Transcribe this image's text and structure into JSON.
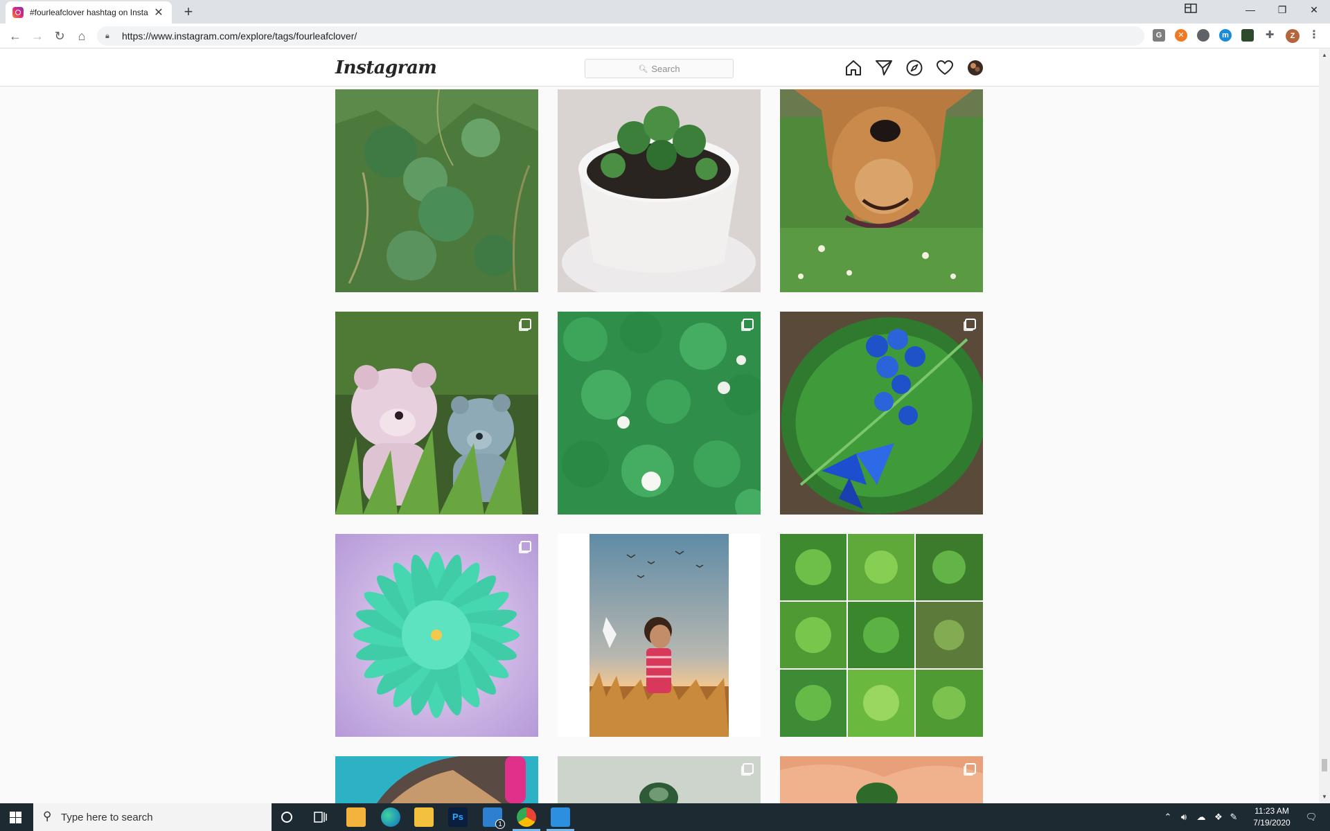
{
  "browser": {
    "tab_title": "#fourleafclover hashtag on Insta",
    "tab_close": "✕",
    "new_tab": "+",
    "url": "https://www.instagram.com/explore/tags/fourleafclover/",
    "profile_initial": "Z"
  },
  "instagram": {
    "logo": "Instagram",
    "search_placeholder": "Search"
  },
  "posts": [
    {
      "subject": "clover-leaves",
      "multi": false
    },
    {
      "subject": "potted-clover",
      "multi": false
    },
    {
      "subject": "dog-in-grass",
      "multi": false
    },
    {
      "subject": "teddy-bears",
      "multi": true
    },
    {
      "subject": "clover-field",
      "multi": true
    },
    {
      "subject": "blue-flowers-leaf",
      "multi": true
    },
    {
      "subject": "teal-flower",
      "multi": true
    },
    {
      "subject": "child-in-field",
      "multi": false
    },
    {
      "subject": "clover-collage",
      "multi": false
    },
    {
      "subject": "hair-pink",
      "multi": false
    },
    {
      "subject": "glass-object",
      "multi": true
    },
    {
      "subject": "clover-in-hand",
      "multi": true
    }
  ],
  "taskbar": {
    "search_placeholder": "Type here to search",
    "time": "11:23 AM",
    "date": "7/19/2020",
    "mail_badge": "1"
  }
}
